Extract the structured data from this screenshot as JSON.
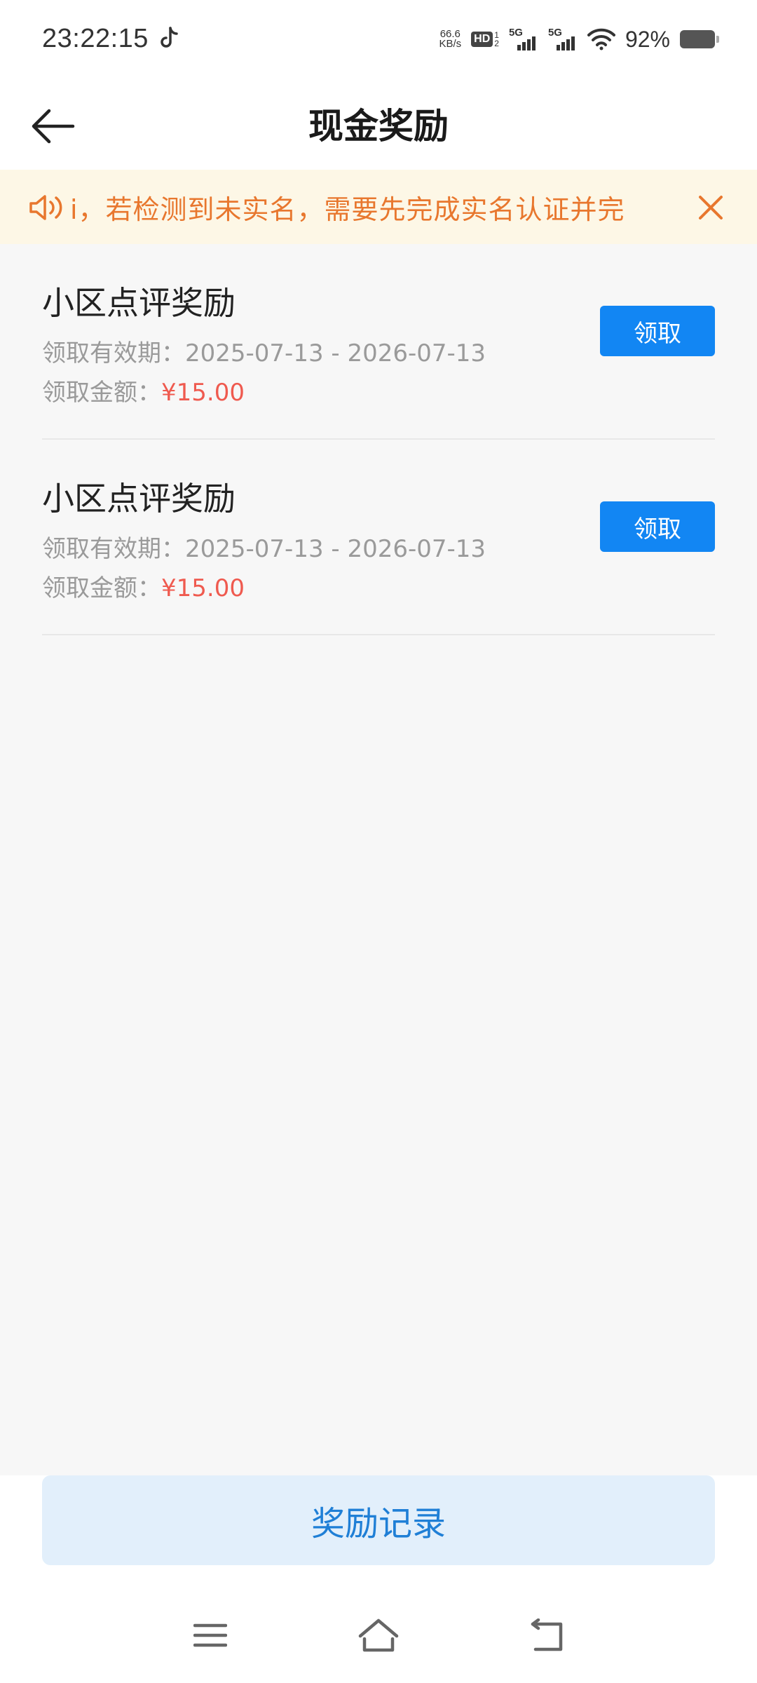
{
  "status_bar": {
    "time": "23:22:15",
    "net_speed_value": "66.6",
    "net_speed_unit": "KB/s",
    "hd_label": "HD",
    "hd_sub_top": "1",
    "hd_sub_bottom": "2",
    "sim1_label": "5G",
    "sim2_label": "5G",
    "battery_percent": "92%",
    "battery_level": 0.92
  },
  "header": {
    "title": "现金奖励",
    "back_icon": "arrow-left-icon"
  },
  "notice": {
    "text": "i，若检测到未实名，需要先完成实名认证并完",
    "speaker_icon": "speaker-icon",
    "close_icon": "close-icon",
    "color": "#e8772e",
    "background": "#fdf7e6"
  },
  "rewards": [
    {
      "title": "小区点评奖励",
      "validity_label": "领取有效期：",
      "validity_range": "2025-07-13 - 2026-07-13",
      "amount_label": "领取金额：",
      "amount": "¥15.00",
      "button_label": "领取"
    },
    {
      "title": "小区点评奖励",
      "validity_label": "领取有效期：",
      "validity_range": "2025-07-13 - 2026-07-13",
      "amount_label": "领取金额：",
      "amount": "¥15.00",
      "button_label": "领取"
    }
  ],
  "bottom": {
    "records_button_label": "奖励记录"
  },
  "nav": {
    "menu_icon": "menu-icon",
    "home_icon": "home-icon",
    "back_icon": "back-nav-icon"
  },
  "colors": {
    "accent": "#1286f3",
    "amount": "#ef5a4f",
    "records_bg": "#e2effb",
    "records_text": "#1f7fd6"
  }
}
